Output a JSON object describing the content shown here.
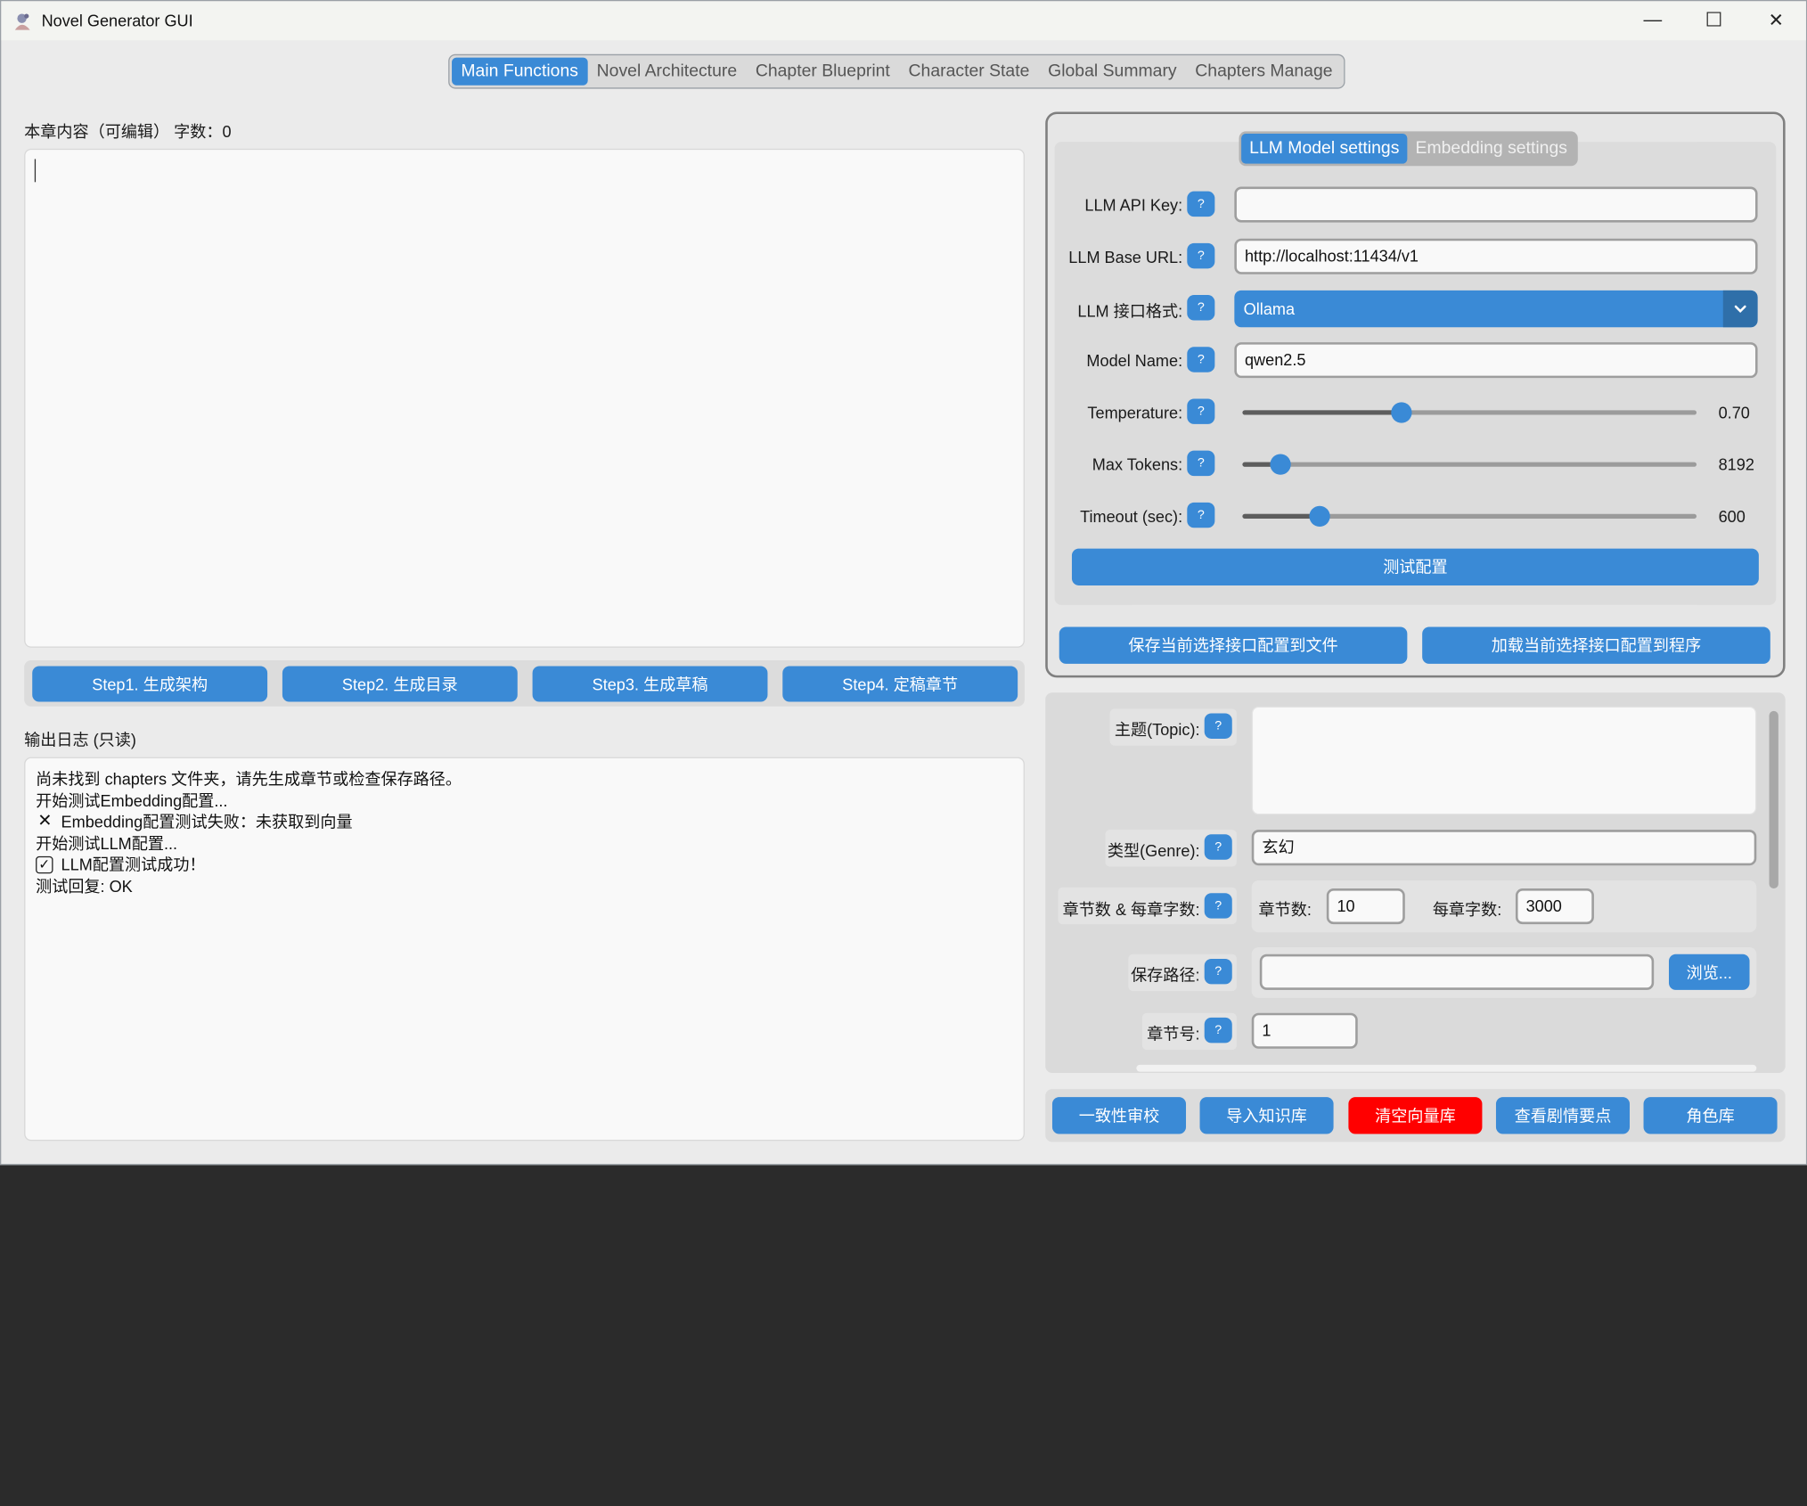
{
  "window": {
    "title": "Novel Generator GUI",
    "minimize_glyph": "—",
    "maximize_glyph": "☐",
    "close_glyph": "✕",
    "app_icon": "app-icon"
  },
  "tabs": [
    {
      "label": "Main Functions",
      "active": true
    },
    {
      "label": "Novel Architecture",
      "active": false
    },
    {
      "label": "Chapter Blueprint",
      "active": false
    },
    {
      "label": "Character State",
      "active": false
    },
    {
      "label": "Global Summary",
      "active": false
    },
    {
      "label": "Chapters Manage",
      "active": false
    }
  ],
  "editor": {
    "label": "本章内容（可编辑）  字数：0",
    "content": ""
  },
  "steps": [
    {
      "label": "Step1. 生成架构"
    },
    {
      "label": "Step2. 生成目录"
    },
    {
      "label": "Step3. 生成草稿"
    },
    {
      "label": "Step4. 定稿章节"
    }
  ],
  "log": {
    "label": "输出日志 (只读)",
    "lines": [
      {
        "icon": "",
        "text": "尚未找到 chapters 文件夹，请先生成章节或检查保存路径。"
      },
      {
        "icon": "",
        "text": "开始测试Embedding配置..."
      },
      {
        "icon": "✕",
        "text": "Embedding配置测试失败：未获取到向量"
      },
      {
        "icon": "",
        "text": "开始测试LLM配置..."
      },
      {
        "icon": "✓",
        "text": "LLM配置测试成功！"
      },
      {
        "icon": "",
        "text": "测试回复: OK"
      }
    ]
  },
  "settings": {
    "tabs": [
      {
        "label": "LLM Model settings",
        "active": true
      },
      {
        "label": "Embedding settings",
        "active": false
      }
    ],
    "help_glyph": "?",
    "api_key": {
      "label": "LLM API Key:",
      "value": ""
    },
    "base_url": {
      "label": "LLM Base URL:",
      "value": "http://localhost:11434/v1"
    },
    "interface": {
      "label": "LLM 接口格式:",
      "value": "Ollama"
    },
    "model_name": {
      "label": "Model Name:",
      "value": "qwen2.5"
    },
    "temperature": {
      "label": "Temperature:",
      "value": "0.70",
      "fraction": 0.35
    },
    "max_tokens": {
      "label": "Max Tokens:",
      "value": "8192",
      "fraction": 0.085
    },
    "timeout": {
      "label": "Timeout (sec):",
      "value": "600",
      "fraction": 0.17
    },
    "test_button": "测试配置",
    "save_button": "保存当前选择接口配置到文件",
    "load_button": "加载当前选择接口配置到程序"
  },
  "novel": {
    "topic": {
      "label": "主题(Topic):",
      "value": ""
    },
    "genre": {
      "label": "类型(Genre):",
      "value": "玄幻"
    },
    "chapters": {
      "label": "章节数 & 每章字数:",
      "num_label": "章节数:",
      "num_value": "10",
      "words_label": "每章字数:",
      "words_value": "3000"
    },
    "save_path": {
      "label": "保存路径:",
      "value": "",
      "browse": "浏览..."
    },
    "chapter_no": {
      "label": "章节号:",
      "value": "1"
    }
  },
  "bottom_buttons": [
    {
      "label": "一致性审校",
      "color": "#3a8ad6"
    },
    {
      "label": "导入知识库",
      "color": "#3a8ad6"
    },
    {
      "label": "清空向量库",
      "color": "#ff0000"
    },
    {
      "label": "查看剧情要点",
      "color": "#3a8ad6"
    },
    {
      "label": "角色库",
      "color": "#3a8ad6"
    }
  ],
  "colors": {
    "accent": "#3a8ad6",
    "danger": "#ff0000",
    "window_bg": "#ebebeb"
  }
}
